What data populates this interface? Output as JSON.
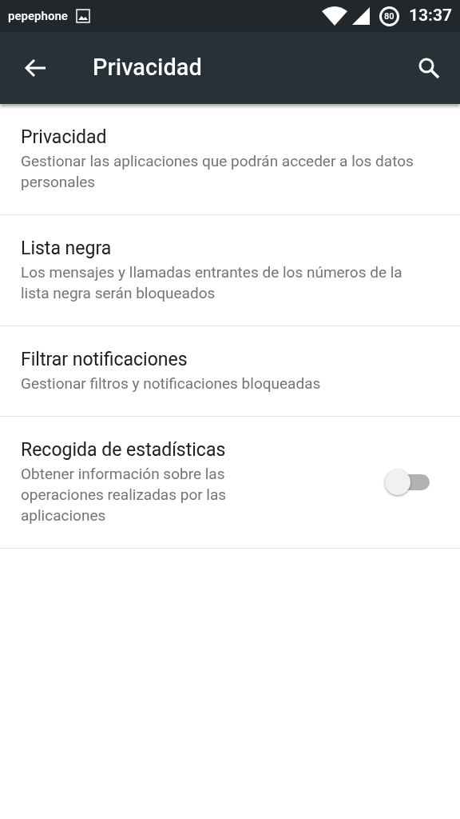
{
  "status_bar": {
    "carrier": "pepephone",
    "battery": "80",
    "time": "13:37"
  },
  "toolbar": {
    "title": "Privacidad"
  },
  "settings": [
    {
      "kind": "item",
      "title": "Privacidad",
      "summary": "Gestionar las aplicaciones que podrán acceder a los datos personales"
    },
    {
      "kind": "item",
      "title": "Lista negra",
      "summary": "Los mensajes y llamadas entrantes de los números de la lista negra serán bloqueados"
    },
    {
      "kind": "item",
      "title": "Filtrar notificaciones",
      "summary": "Gestionar filtros y notificaciones bloqueadas"
    },
    {
      "kind": "switch",
      "title": "Recogida de estadísticas",
      "summary": "Obtener información sobre las operaciones realizadas por las aplicaciones",
      "on": false
    }
  ]
}
